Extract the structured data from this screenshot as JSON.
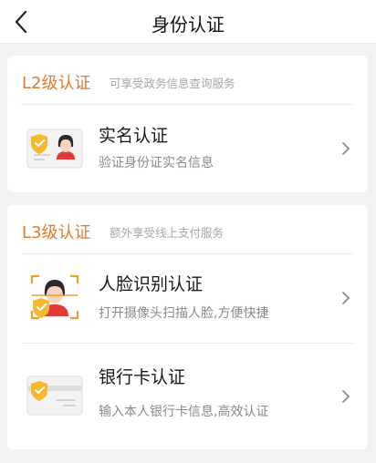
{
  "header": {
    "title": "身份认证",
    "back_icon": "chevron-left-icon"
  },
  "colors": {
    "accent": "#e07b2b",
    "shield": "#f5b82e",
    "avatar_shirt": "#e03b3b"
  },
  "sections": [
    {
      "level": "L2级认证",
      "desc": "可享受政务信息查询服务",
      "items": [
        {
          "title": "实名认证",
          "subtitle": "验证身份证实名信息",
          "icon": "id-card-icon"
        }
      ]
    },
    {
      "level": "L3级认证",
      "desc": "额外享受线上支付服务",
      "items": [
        {
          "title": "人脸识别认证",
          "subtitle": "打开摄像头扫描人脸,方便快捷",
          "icon": "face-scan-icon"
        },
        {
          "title": "银行卡认证",
          "subtitle": "输入本人银行卡信息,高效认证",
          "icon": "bank-card-icon"
        }
      ]
    }
  ]
}
